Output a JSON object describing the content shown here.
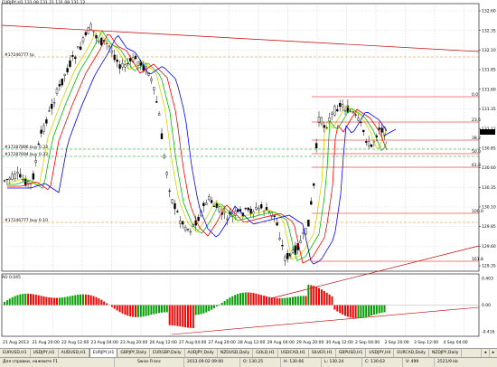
{
  "chart": {
    "symbol_header": "EURJPY,H1  131.08 131.21 131.08 131.12",
    "oscillator_label": "AO 0.045",
    "price_scale": [
      "132.60",
      "132.35",
      "132.10",
      "131.85",
      "131.60",
      "131.35",
      "131.12",
      "130.85",
      "130.60",
      "130.35",
      "130.10",
      "129.85",
      "129.60",
      "129.35"
    ],
    "oscillator_scale": [
      "0.403",
      "0.00",
      "-0.416"
    ],
    "current_price": "131.12",
    "object_labels": [
      {
        "text": "#17246777 tp",
        "color": "#000000"
      },
      {
        "text": "#17287896 buy 0.33",
        "color": "#000000"
      },
      {
        "text": "#17287694 buy 0.33",
        "color": "#000000"
      },
      {
        "text": "#17246777 buy 0.10",
        "color": "#000000"
      }
    ],
    "fib_labels": [
      "0.0",
      "23.6",
      "38.2",
      "50.0",
      "61.8",
      "100.0",
      "161.8"
    ],
    "time_labels": [
      "21 Aug 2013",
      "21 Aug 20:00",
      "22 Aug 12:00",
      "23 Aug 04:00",
      "23 Aug 20:00",
      "26 Aug 12:00",
      "27 Aug 04:00",
      "27 Aug 20:00",
      "28 Aug 12:00",
      "29 Aug 04:00",
      "29 Aug 20:00",
      "30 Aug 12:00",
      "2 Sep 04:00",
      "2 Sep 20:00",
      "3 Sep 12:00",
      "4 Sep 04:00"
    ],
    "colors": {
      "bull": "#ffffff",
      "bear": "#000000",
      "ma_red": "#ff0000",
      "ma_yellow": "#d4d400",
      "ma_green": "#00c000",
      "ma_blue": "#0000ff",
      "ao_up": "#00a000",
      "ao_down": "#ff0000",
      "trend": "#c00000"
    }
  },
  "tabs": [
    "EURUSD,H1",
    "USDJPY,H1",
    "AUDUSD,H1",
    "EURJPY,H1",
    "GBPJPY,Daily",
    "EURGBP,Daily",
    "AUDJPY,Daily",
    "NZDUSD,Daily",
    "GOLD,H1",
    "USDCAD,H1",
    "SILVER,H1",
    "GBPUSD,H1",
    "USDJPY,H4",
    "EURCAD,Daily",
    "NZDJPY,Daily"
  ],
  "active_tab": "EURJPY,H1",
  "status": {
    "help": "Для справки, нажмите F1",
    "profile": "Swiss Franc",
    "datetime": "2013.09.02 09:00",
    "open": "O: 130.25",
    "high": "H: 130.66",
    "low": "L: 130.24",
    "close": "C: 130.63",
    "volume": "V: 499",
    "traffic": "2521/9 kb"
  }
}
